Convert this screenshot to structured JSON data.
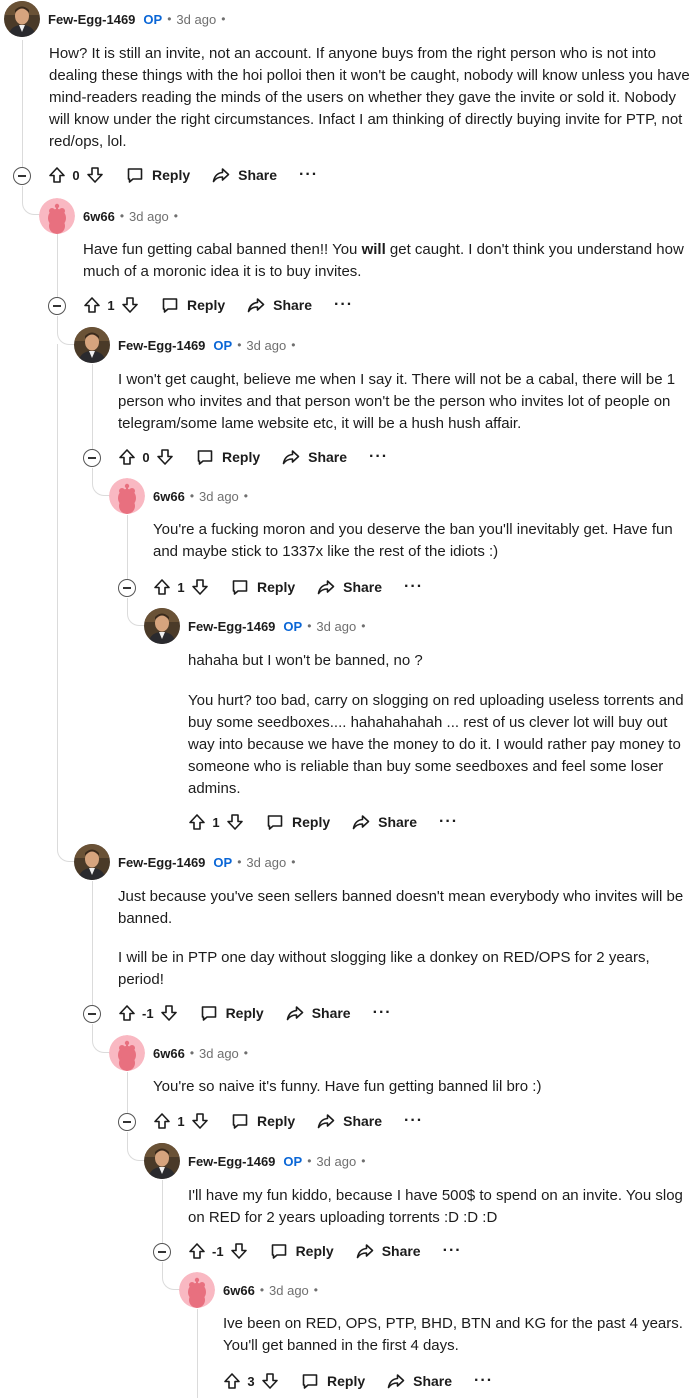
{
  "labels": {
    "op": "OP",
    "reply": "Reply",
    "share": "Share",
    "more": "···",
    "dot": "•"
  },
  "comments": [
    {
      "author": "Few-Egg-1469",
      "op": true,
      "time": "3d ago",
      "score": "0",
      "paragraphs": [
        "How? It is still an invite, not an account. If anyone buys from the right person who is not into dealing these things with the hoi polloi then it won't be caught, nobody will know unless you have mind-readers reading the minds of the users on whether they gave the invite or sold it. Nobody will know under the right circumstances. Infact I am thinking of directly buying invite for PTP, not red/ops, lol."
      ]
    },
    {
      "author": "6w66",
      "op": false,
      "time": "3d ago",
      "score": "1",
      "paragraphs": [
        "Have fun getting cabal banned then!! You will get caught. I don't think you understand how much of a moronic idea it is to buy invites."
      ]
    },
    {
      "author": "Few-Egg-1469",
      "op": true,
      "time": "3d ago",
      "score": "0",
      "paragraphs": [
        "I won't get caught, believe me when I say it. There will not be a cabal, there will be 1 person who invites and that person won't be the person who invites lot of people on telegram/some lame website etc, it will be a hush hush affair."
      ]
    },
    {
      "author": "6w66",
      "op": false,
      "time": "3d ago",
      "score": "1",
      "paragraphs": [
        "You're a fucking moron and you deserve the ban you'll inevitably get. Have fun and maybe stick to 1337x like the rest of the idiots :)"
      ]
    },
    {
      "author": "Few-Egg-1469",
      "op": true,
      "time": "3d ago",
      "score": "1",
      "paragraphs": [
        "hahaha but I won't be banned, no ?",
        "You hurt? too bad, carry on slogging on red uploading useless torrents and buy some seedboxes.... hahahahahah ... rest of us clever lot will buy out way into because we have the money to do it. I would rather pay money to someone who is reliable than buy some seedboxes and feel some loser admins."
      ]
    },
    {
      "author": "Few-Egg-1469",
      "op": true,
      "time": "3d ago",
      "score": "-1",
      "paragraphs": [
        "Just because you've seen sellers banned doesn't mean everybody who invites will be banned.",
        "I will be in PTP one day without slogging like a donkey on RED/OPS for 2 years, period!"
      ]
    },
    {
      "author": "6w66",
      "op": false,
      "time": "3d ago",
      "score": "1",
      "paragraphs": [
        "You're so naive it's funny. Have fun getting banned lil bro :)"
      ]
    },
    {
      "author": "Few-Egg-1469",
      "op": true,
      "time": "3d ago",
      "score": "-1",
      "paragraphs": [
        "I'll have my fun kiddo, because I have 500$ to spend on an invite. You slog on RED for 2 years uploading torrents :D :D :D"
      ]
    },
    {
      "author": "6w66",
      "op": false,
      "time": "3d ago",
      "score": "3",
      "paragraphs": [
        "Ive been on RED, OPS, PTP, BHD, BTN and KG for the past 4 years. You'll get banned in the first 4 days."
      ]
    }
  ]
}
